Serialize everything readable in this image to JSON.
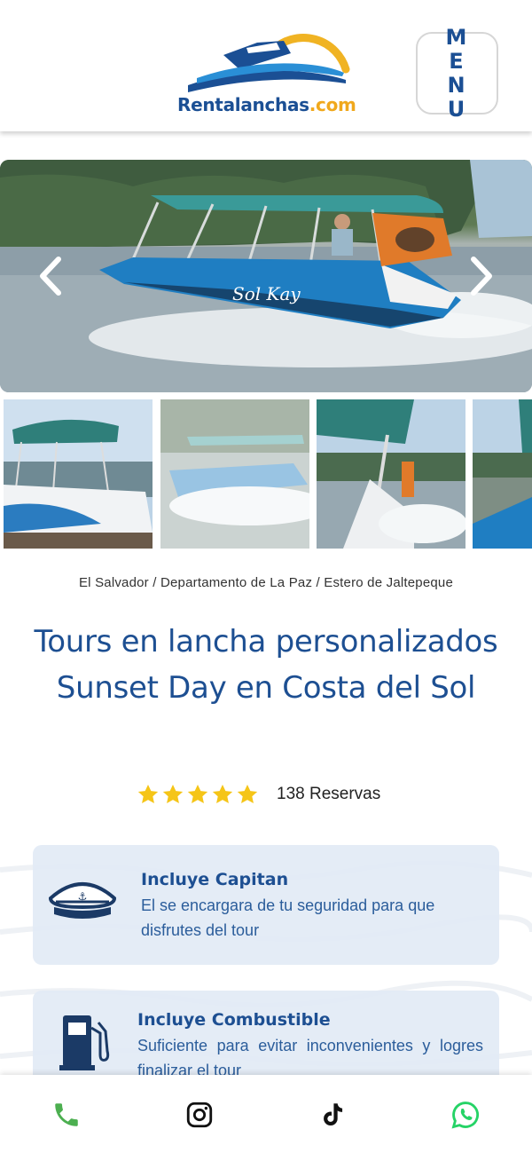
{
  "header": {
    "logo_text_main": "Rentalanchas",
    "logo_text_suffix": ".com",
    "menu_label": "MENU"
  },
  "hero": {
    "boat_hull_text": "Sol Kay"
  },
  "breadcrumb": "El Salvador / Departamento de La Paz / Estero de Jaltepeque",
  "title": "Tours en lancha personalizados Sunset Day en Costa del Sol",
  "rating": {
    "stars": 5,
    "reservas": "138 Reservas"
  },
  "features": [
    {
      "icon": "captain-hat-icon",
      "title": "Incluye Capitan",
      "description": "El se encargara de tu seguridad para que disfrutes del tour"
    },
    {
      "icon": "fuel-pump-icon",
      "title": "Incluye Combustible",
      "description": "Suficiente para evitar inconvenientes y logres finalizar el tour"
    }
  ],
  "bottom_bar": [
    "phone-icon",
    "instagram-icon",
    "tiktok-icon",
    "whatsapp-icon"
  ],
  "colors": {
    "brand_blue": "#1d4f92",
    "accent_orange": "#f0a81c",
    "star_gold": "#f5c518",
    "whatsapp_green": "#25d366",
    "phone_green": "#4caf50"
  }
}
